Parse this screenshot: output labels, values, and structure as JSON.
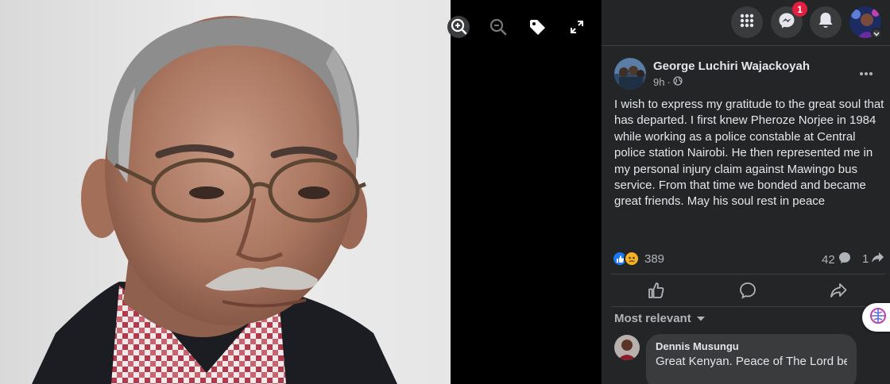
{
  "viewer": {
    "tools": [
      "zoom-in-icon",
      "zoom-out-icon",
      "tag-icon",
      "fullscreen-icon"
    ]
  },
  "header": {
    "notification_badge": "1",
    "buttons": [
      "grid-menu-icon",
      "messenger-icon",
      "bell-icon"
    ]
  },
  "post": {
    "author": "George Luchiri Wajackoyah",
    "time": "9h",
    "separator": "·",
    "privacy_icon": "globe-icon",
    "text": "I wish to express my gratitude to the great soul that has departed. I first knew Pheroze Norjee in 1984 while working as a police constable at Central police station Nairobi. He then represented me in my personal injury claim against Mawingo bus service. From that time we bonded and became great friends. May his soul rest in peace",
    "reaction_count": "389",
    "comment_count": "42",
    "share_count": "1"
  },
  "actions": [
    "like-icon",
    "comment-icon",
    "share-icon"
  ],
  "comments": {
    "sort_label": "Most relevant",
    "items": [
      {
        "name": "Dennis Musungu",
        "text": "Great Kenyan. Peace of The Lord be"
      }
    ]
  },
  "colors": {
    "panel_bg": "#242526",
    "surface": "#3a3b3c",
    "text_primary": "#e4e6eb",
    "text_secondary": "#b0b3b8",
    "badge_red": "#e41e3f",
    "like_blue": "#1877f2",
    "sad_yellow": "#f7b125"
  }
}
